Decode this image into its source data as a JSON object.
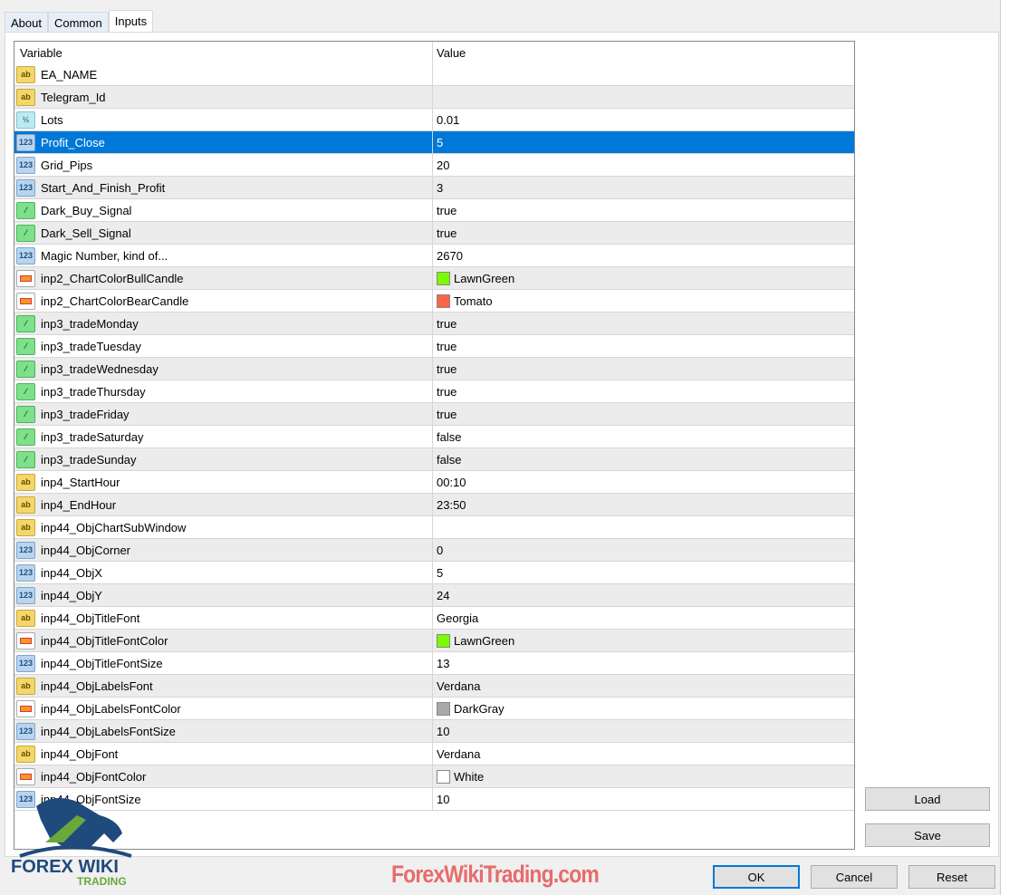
{
  "tabs": [
    "About",
    "Common",
    "Inputs"
  ],
  "active_tab": "Inputs",
  "columns": {
    "variable": "Variable",
    "value": "Value"
  },
  "rows": [
    {
      "type": "string",
      "name": "EA_NAME",
      "value": ""
    },
    {
      "type": "string",
      "name": "Telegram_Id",
      "value": ""
    },
    {
      "type": "double",
      "name": "Lots",
      "value": "0.01"
    },
    {
      "type": "int",
      "name": "Profit_Close",
      "value": "5",
      "selected": true
    },
    {
      "type": "int",
      "name": "Grid_Pips",
      "value": "20"
    },
    {
      "type": "int",
      "name": "Start_And_Finish_Profit",
      "value": "3"
    },
    {
      "type": "bool",
      "name": "Dark_Buy_Signal",
      "value": "true"
    },
    {
      "type": "bool",
      "name": "Dark_Sell_Signal",
      "value": "true"
    },
    {
      "type": "int",
      "name": "Magic Number, kind of...",
      "value": "2670"
    },
    {
      "type": "color",
      "name": "inp2_ChartColorBullCandle",
      "value": "LawnGreen",
      "swatch": "#7cfc00"
    },
    {
      "type": "color",
      "name": "inp2_ChartColorBearCandle",
      "value": "Tomato",
      "swatch": "#ff6347"
    },
    {
      "type": "bool",
      "name": "inp3_tradeMonday",
      "value": "true"
    },
    {
      "type": "bool",
      "name": "inp3_tradeTuesday",
      "value": "true"
    },
    {
      "type": "bool",
      "name": "inp3_tradeWednesday",
      "value": "true"
    },
    {
      "type": "bool",
      "name": "inp3_tradeThursday",
      "value": "true"
    },
    {
      "type": "bool",
      "name": "inp3_tradeFriday",
      "value": "true"
    },
    {
      "type": "bool",
      "name": "inp3_tradeSaturday",
      "value": "false"
    },
    {
      "type": "bool",
      "name": "inp3_tradeSunday",
      "value": "false"
    },
    {
      "type": "string",
      "name": "inp4_StartHour",
      "value": "00:10"
    },
    {
      "type": "string",
      "name": "inp4_EndHour",
      "value": "23:50"
    },
    {
      "type": "string",
      "name": "inp44_ObjChartSubWindow",
      "value": ""
    },
    {
      "type": "int",
      "name": "inp44_ObjCorner",
      "value": "0"
    },
    {
      "type": "int",
      "name": "inp44_ObjX",
      "value": "5"
    },
    {
      "type": "int",
      "name": "inp44_ObjY",
      "value": "24"
    },
    {
      "type": "string",
      "name": "inp44_ObjTitleFont",
      "value": "Georgia"
    },
    {
      "type": "color",
      "name": "inp44_ObjTitleFontColor",
      "value": "LawnGreen",
      "swatch": "#7cfc00"
    },
    {
      "type": "int",
      "name": "inp44_ObjTitleFontSize",
      "value": "13"
    },
    {
      "type": "string",
      "name": "inp44_ObjLabelsFont",
      "value": "Verdana"
    },
    {
      "type": "color",
      "name": "inp44_ObjLabelsFontColor",
      "value": "DarkGray",
      "swatch": "#a9a9a9"
    },
    {
      "type": "int",
      "name": "inp44_ObjLabelsFontSize",
      "value": "10"
    },
    {
      "type": "string",
      "name": "inp44_ObjFont",
      "value": "Verdana"
    },
    {
      "type": "color",
      "name": "inp44_ObjFontColor",
      "value": "White",
      "swatch": "#ffffff"
    },
    {
      "type": "int",
      "name": "inp44_ObjFontSize",
      "value": "10"
    }
  ],
  "icon_glyphs": {
    "string": "ab",
    "double": "½",
    "int": "123",
    "bool": "⁄",
    "color": ""
  },
  "buttons": {
    "load": "Load",
    "save": "Save",
    "ok": "OK",
    "cancel": "Cancel",
    "reset": "Reset"
  },
  "watermark": {
    "logo_text": "FOREX WIKI TRADING",
    "url": "ForexWikiTrading.com"
  }
}
